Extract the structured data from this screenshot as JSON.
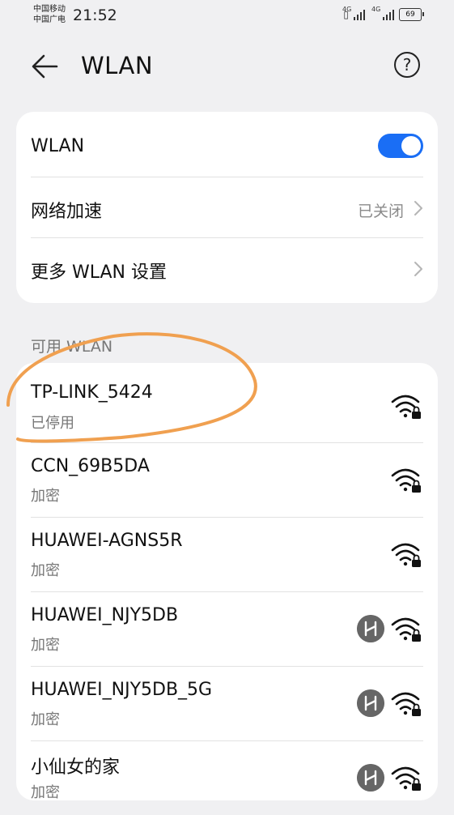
{
  "status_bar": {
    "carrier_1": "中国移动",
    "carrier_2": "中国广电",
    "time": "21:52",
    "network_1": "4G",
    "network_2": "4G",
    "battery": "69"
  },
  "header": {
    "title": "WLAN",
    "back_icon": "arrow-left-icon",
    "help_icon": "question-circle-icon",
    "help_glyph": "?"
  },
  "settings": {
    "wlan_label": "WLAN",
    "wlan_enabled": true,
    "accel_label": "网络加速",
    "accel_value": "已关闭",
    "more_label": "更多 WLAN 设置"
  },
  "available": {
    "title": "可用 WLAN",
    "networks": [
      {
        "name": "TP-LINK_5424",
        "status": "已停用",
        "huawei_badge": false
      },
      {
        "name": "CCN_69B5DA",
        "status": "加密",
        "huawei_badge": false
      },
      {
        "name": "HUAWEI-AGNS5R",
        "status": "加密",
        "huawei_badge": false
      },
      {
        "name": "HUAWEI_NJY5DB",
        "status": "加密",
        "huawei_badge": true
      },
      {
        "name": "HUAWEI_NJY5DB_5G",
        "status": "加密",
        "huawei_badge": true
      },
      {
        "name": "小仙女的家",
        "status": "加密",
        "huawei_badge": true
      }
    ]
  },
  "colors": {
    "accent": "#1a6ef5",
    "annotation": "#f0a050"
  }
}
